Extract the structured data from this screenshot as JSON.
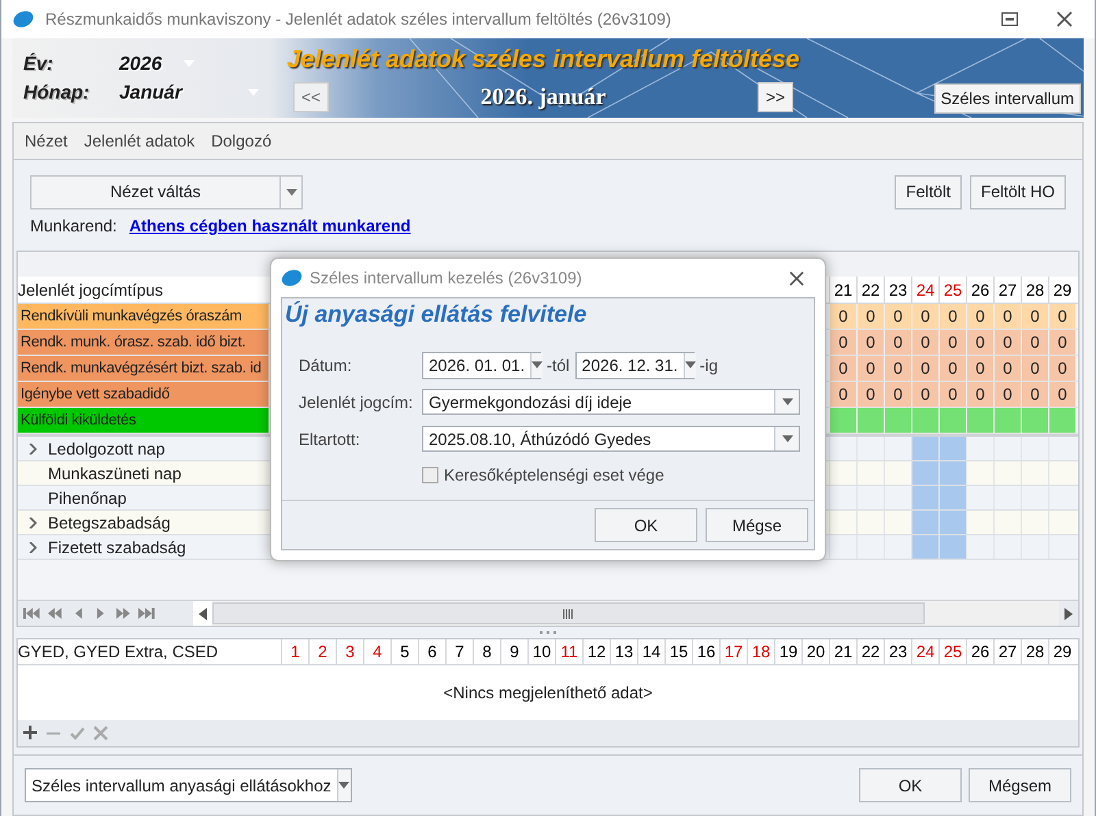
{
  "window": {
    "title": "Részmunkaidős munkaviszony - Jelenlét adatok széles intervallum feltöltés (26v3109)"
  },
  "banner": {
    "year_label": "Év:",
    "year": "2026",
    "month_label": "Hónap:",
    "month": "Január",
    "prev": "<<",
    "title": "Jelenlét adatok széles intervallum feltöltése",
    "period": "2026. január",
    "next": ">>",
    "mode_button": "Széles intervallum"
  },
  "menu": [
    "Nézet",
    "Jelenlét adatok",
    "Dolgozó"
  ],
  "toolbar": {
    "view_combo": "Nézet váltás",
    "buttons": [
      "Feltölt",
      "Feltölt HO"
    ]
  },
  "schedule": {
    "label": "Munkarend:",
    "link": "Athens cégben használt munkarend"
  },
  "attendance_grid": {
    "header": "Jelenlét jogcímtípus",
    "days": [
      {
        "label": "21",
        "weekend": false
      },
      {
        "label": "22",
        "weekend": false
      },
      {
        "label": "23",
        "weekend": false
      },
      {
        "label": "24",
        "weekend": true
      },
      {
        "label": "25",
        "weekend": true
      },
      {
        "label": "26",
        "weekend": false
      },
      {
        "label": "27",
        "weekend": false
      },
      {
        "label": "28",
        "weekend": false
      },
      {
        "label": "29",
        "weekend": false
      }
    ],
    "rows": [
      {
        "label": "Rendkívüli munkavégzés óraszám",
        "color": "#ffb860",
        "values": [
          "0",
          "0",
          "0",
          "0",
          "0",
          "0",
          "0",
          "0",
          "0"
        ]
      },
      {
        "label": "Rendk. munk. órasz. szab. idő bizt.",
        "color": "#ee9560",
        "values": [
          "0",
          "0",
          "0",
          "0",
          "0",
          "0",
          "0",
          "0",
          "0"
        ]
      },
      {
        "label": "Rendk. munkavégzésért bizt. szab. id",
        "color": "#ee9560",
        "values": [
          "0",
          "0",
          "0",
          "0",
          "0",
          "0",
          "0",
          "0",
          "0"
        ]
      },
      {
        "label": "Igénybe vett szabadidő",
        "color": "#ee9560",
        "values": [
          "0",
          "0",
          "0",
          "0",
          "0",
          "0",
          "0",
          "0",
          "0"
        ]
      },
      {
        "label": "Külföldi kiküldetés",
        "color": "#00c800"
      }
    ],
    "tree": [
      {
        "label": "Ledolgozott nap",
        "expandable": true
      },
      {
        "label": "Munkaszüneti nap",
        "expandable": false
      },
      {
        "label": "Pihenőnap",
        "expandable": false
      },
      {
        "label": "Betegszabadság",
        "expandable": true
      },
      {
        "label": "Fizetett szabadság",
        "expandable": true
      }
    ]
  },
  "gyed_grid": {
    "header": "GYED, GYED Extra, CSED",
    "days": [
      {
        "label": "1",
        "weekend": true
      },
      {
        "label": "2",
        "weekend": true
      },
      {
        "label": "3",
        "weekend": true
      },
      {
        "label": "4",
        "weekend": true
      },
      {
        "label": "5",
        "weekend": false
      },
      {
        "label": "6",
        "weekend": false
      },
      {
        "label": "7",
        "weekend": false
      },
      {
        "label": "8",
        "weekend": false
      },
      {
        "label": "9",
        "weekend": false
      },
      {
        "label": "10",
        "weekend": false
      },
      {
        "label": "11",
        "weekend": true
      },
      {
        "label": "12",
        "weekend": false
      },
      {
        "label": "13",
        "weekend": false
      },
      {
        "label": "14",
        "weekend": false
      },
      {
        "label": "15",
        "weekend": false
      },
      {
        "label": "16",
        "weekend": false
      },
      {
        "label": "17",
        "weekend": true
      },
      {
        "label": "18",
        "weekend": true
      },
      {
        "label": "19",
        "weekend": false
      },
      {
        "label": "20",
        "weekend": false
      },
      {
        "label": "21",
        "weekend": false
      },
      {
        "label": "22",
        "weekend": false
      },
      {
        "label": "23",
        "weekend": false
      },
      {
        "label": "24",
        "weekend": true
      },
      {
        "label": "25",
        "weekend": true
      },
      {
        "label": "26",
        "weekend": false
      },
      {
        "label": "27",
        "weekend": false
      },
      {
        "label": "28",
        "weekend": false
      },
      {
        "label": "29",
        "weekend": false
      }
    ],
    "empty_text": "<Nincs megjeleníthető adat>"
  },
  "footer": {
    "combo": "Széles intervallum anyasági ellátásokhoz",
    "buttons": [
      "OK",
      "Mégsem"
    ]
  },
  "dialog": {
    "title": "Széles intervallum kezelés (26v3109)",
    "heading": "Új anyasági ellátás felvitele",
    "date_label": "Dátum:",
    "date_from": "2026. 01. 01.",
    "from_suffix": "-tól",
    "date_to": "2026. 12. 31.",
    "to_suffix": "-ig",
    "type_label": "Jelenlét jogcím:",
    "type": "Gyermekgondozási díj ideje",
    "dependent_label": "Eltartott:",
    "dependent": "2025.08.10, Áthúzódó Gyedes",
    "end_checkbox": {
      "label": "Keresőképtelenségi eset vége",
      "checked": false
    },
    "buttons": [
      "OK",
      "Mégse"
    ]
  }
}
